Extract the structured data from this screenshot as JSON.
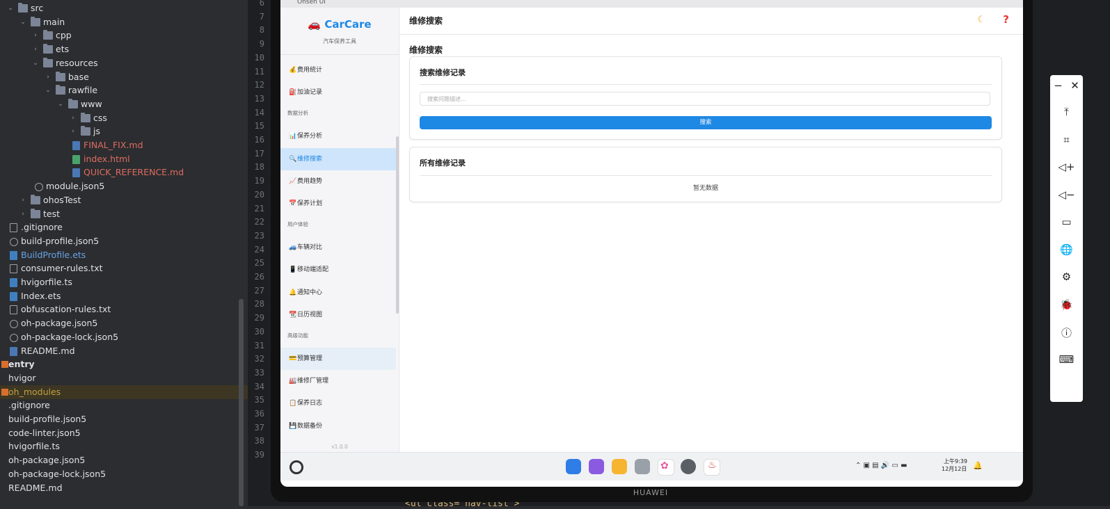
{
  "project_tree": [
    {
      "label": "src",
      "depth": 0,
      "kind": "folder",
      "open": true
    },
    {
      "label": "main",
      "depth": 1,
      "kind": "folder",
      "open": true
    },
    {
      "label": "cpp",
      "depth": 2,
      "kind": "folder",
      "open": false
    },
    {
      "label": "ets",
      "depth": 2,
      "kind": "folder",
      "open": false
    },
    {
      "label": "resources",
      "depth": 2,
      "kind": "folder",
      "open": true
    },
    {
      "label": "base",
      "depth": 3,
      "kind": "folder",
      "open": false
    },
    {
      "label": "rawfile",
      "depth": 3,
      "kind": "folder",
      "open": true
    },
    {
      "label": "www",
      "depth": 4,
      "kind": "folder",
      "open": true
    },
    {
      "label": "css",
      "depth": 5,
      "kind": "folder",
      "open": false
    },
    {
      "label": "js",
      "depth": 5,
      "kind": "folder",
      "open": false
    },
    {
      "label": "FINAL_FIX.md",
      "depth": 5,
      "kind": "md",
      "color": "red"
    },
    {
      "label": "index.html",
      "depth": 5,
      "kind": "html",
      "color": "red"
    },
    {
      "label": "QUICK_REFERENCE.md",
      "depth": 5,
      "kind": "md",
      "color": "red"
    },
    {
      "label": "module.json5",
      "depth": 2,
      "kind": "json"
    },
    {
      "label": "ohosTest",
      "depth": 1,
      "kind": "folder",
      "open": false
    },
    {
      "label": "test",
      "depth": 1,
      "kind": "folder",
      "open": false
    },
    {
      "label": ".gitignore",
      "depth": 0,
      "kind": "txt"
    },
    {
      "label": "build-profile.json5",
      "depth": 0,
      "kind": "json"
    },
    {
      "label": "BuildProfile.ets",
      "depth": 0,
      "kind": "ts",
      "color": "blue"
    },
    {
      "label": "consumer-rules.txt",
      "depth": 0,
      "kind": "txt"
    },
    {
      "label": "hvigorfile.ts",
      "depth": 0,
      "kind": "ts"
    },
    {
      "label": "Index.ets",
      "depth": 0,
      "kind": "ts"
    },
    {
      "label": "obfuscation-rules.txt",
      "depth": 0,
      "kind": "txt"
    },
    {
      "label": "oh-package.json5",
      "depth": 0,
      "kind": "json"
    },
    {
      "label": "oh-package-lock.json5",
      "depth": 0,
      "kind": "json"
    },
    {
      "label": "README.md",
      "depth": 0,
      "kind": "md"
    },
    {
      "label": "entry",
      "depth": -1,
      "kind": "sq",
      "bold": true
    },
    {
      "label": "hvigor",
      "depth": -1,
      "kind": "none"
    },
    {
      "label": "oh_modules",
      "depth": -1,
      "kind": "sq",
      "color": "gold",
      "highlight": true
    },
    {
      "label": ".gitignore",
      "depth": -1,
      "kind": "none"
    },
    {
      "label": "build-profile.json5",
      "depth": -1,
      "kind": "none"
    },
    {
      "label": "code-linter.json5",
      "depth": -1,
      "kind": "none"
    },
    {
      "label": "hvigorfile.ts",
      "depth": -1,
      "kind": "none"
    },
    {
      "label": "oh-package.json5",
      "depth": -1,
      "kind": "none"
    },
    {
      "label": "oh-package-lock.json5",
      "depth": -1,
      "kind": "none"
    },
    {
      "label": "README.md",
      "depth": -1,
      "kind": "none"
    }
  ],
  "line_numbers": [
    "6",
    "7",
    "8",
    "9",
    "10",
    "11",
    "12",
    "13",
    "14",
    "15",
    "16",
    "17",
    "18",
    "19",
    "20",
    "21",
    "22",
    "23",
    "24",
    "25",
    "26",
    "27",
    "28",
    "29",
    "30",
    "31",
    "32",
    "33",
    "34",
    "35",
    "36",
    "37",
    "38",
    "39"
  ],
  "code_line": "<ul class=\"nav-list\">",
  "emulator": {
    "window_title": "Onsen UI",
    "brand": "🚗 CarCare",
    "brand_subtitle": "汽车保养工具",
    "nav": [
      {
        "type": "item",
        "icon": "💰",
        "label": "费用统计"
      },
      {
        "type": "item",
        "icon": "⛽",
        "label": "加油记录"
      },
      {
        "type": "section",
        "label": "数据分析"
      },
      {
        "type": "item",
        "icon": "📊",
        "label": "保养分析"
      },
      {
        "type": "item",
        "icon": "🔍",
        "label": "维修搜索",
        "active": true
      },
      {
        "type": "item",
        "icon": "📈",
        "label": "费用趋势"
      },
      {
        "type": "item",
        "icon": "📅",
        "label": "保养计划"
      },
      {
        "type": "section",
        "label": "用户体验"
      },
      {
        "type": "item",
        "icon": "🚙",
        "label": "车辆对比"
      },
      {
        "type": "item",
        "icon": "📱",
        "label": "移动端适配"
      },
      {
        "type": "item",
        "icon": "🔔",
        "label": "通知中心"
      },
      {
        "type": "item",
        "icon": "📆",
        "label": "日历视图"
      },
      {
        "type": "section",
        "label": "高级功能"
      },
      {
        "type": "item",
        "icon": "💳",
        "label": "预算管理",
        "hover": true
      },
      {
        "type": "item",
        "icon": "🏭",
        "label": "维修厂管理"
      },
      {
        "type": "item",
        "icon": "📋",
        "label": "保养日志"
      },
      {
        "type": "item",
        "icon": "💾",
        "label": "数据备份"
      }
    ],
    "version": "v1.0.0",
    "header_title": "维修搜索",
    "page_heading": "维修搜索",
    "search_card_title": "搜索维修记录",
    "search_placeholder": "搜索问题描述...",
    "search_button": "搜索",
    "records_card_title": "所有维修记录",
    "empty_text": "暂无数据",
    "clock_time": "上午9:39",
    "clock_date": "12月12日",
    "device_brand": "HUAWEI"
  },
  "colors": {
    "accent": "#1e88e5",
    "active_bg": "#cfe5fb",
    "ide_bg": "#2b2d30",
    "file_red": "#e06c60",
    "file_blue": "#6aa3e6"
  },
  "tools": [
    "minimize-icon",
    "close-icon",
    "to-top-icon",
    "crop-icon",
    "volume-up-icon",
    "volume-down-icon",
    "rotate-icon",
    "globe-icon",
    "settings-icon",
    "bug-icon",
    "info-icon",
    "keyboard-icon"
  ]
}
